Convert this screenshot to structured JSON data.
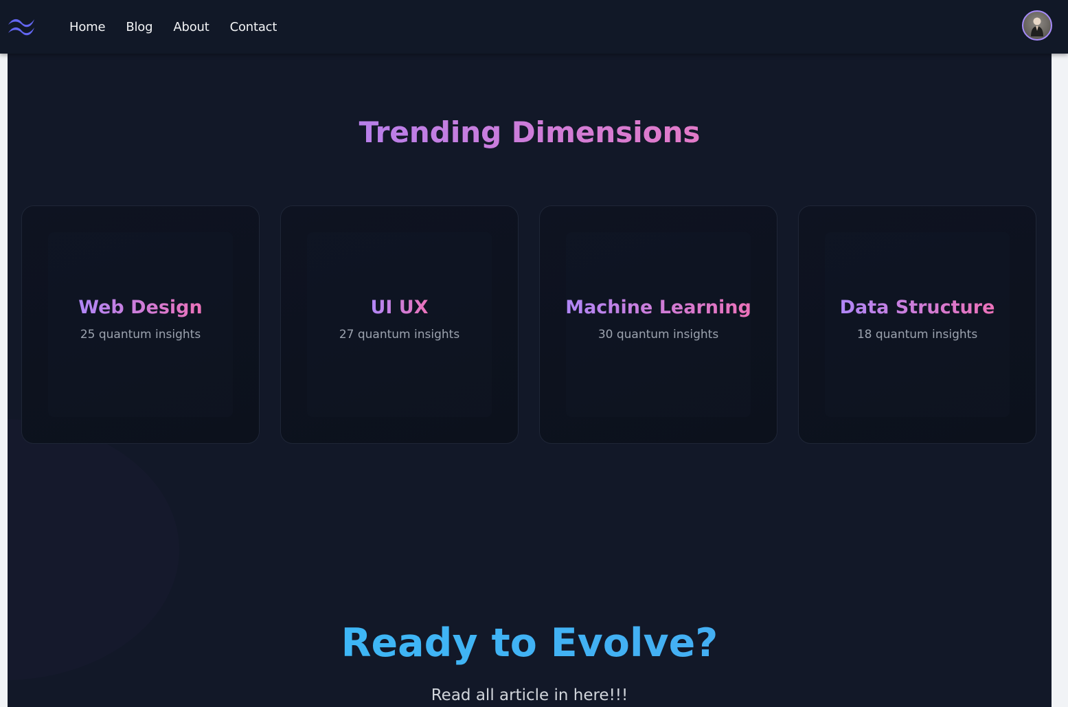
{
  "nav": {
    "logo_icon": "tailwind-wave-icon",
    "links": [
      {
        "label": "Home"
      },
      {
        "label": "Blog"
      },
      {
        "label": "About"
      },
      {
        "label": "Contact"
      }
    ],
    "avatar_icon": "user-avatar",
    "colors": {
      "logo": "#6366f1",
      "avatar_border": "#a78bfa"
    }
  },
  "trending": {
    "title": "Trending Dimensions",
    "cards": [
      {
        "title": "Web Design",
        "subtitle": "25 quantum insights"
      },
      {
        "title": "UI UX",
        "subtitle": "27 quantum insights"
      },
      {
        "title": "Machine Learning",
        "subtitle": "30 quantum insights"
      },
      {
        "title": "Data Structure",
        "subtitle": "18 quantum insights"
      }
    ]
  },
  "cta": {
    "title": "Ready to Evolve?",
    "subtitle": "Read all article in here!!!"
  },
  "colors": {
    "background": "#121828",
    "navbar": "#111827",
    "title_gradient": [
      "#c084fc",
      "#e879c9"
    ],
    "cta_gradient": [
      "#38bdf8",
      "#4aa8f0"
    ]
  }
}
